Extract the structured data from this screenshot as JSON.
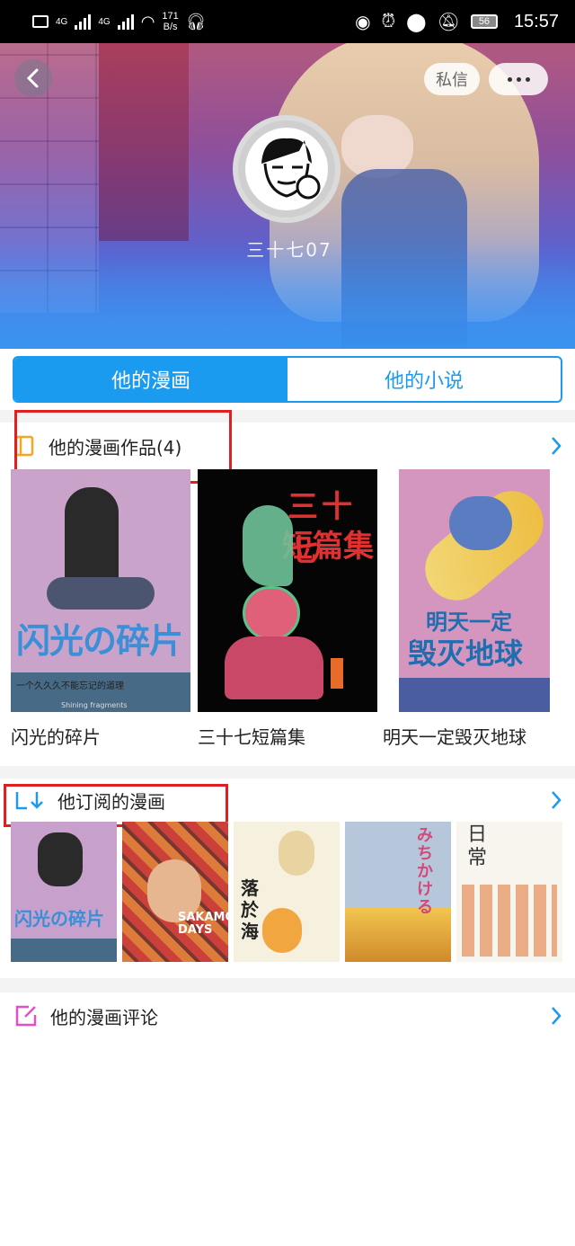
{
  "status_bar": {
    "speed_value": "171",
    "speed_unit": "B/s",
    "network_1": "4G",
    "network_2": "4G",
    "battery": "56",
    "time": "15:57"
  },
  "header": {
    "message_button": "私信",
    "username": "三十七07"
  },
  "tabs": [
    {
      "label": "他的漫画",
      "active": true
    },
    {
      "label": "他的小说",
      "active": false
    }
  ],
  "works_section": {
    "title": "他的漫画作品(4)",
    "items": [
      {
        "title": "闪光的碎片",
        "cover_text": "闪光の碎片",
        "cover_subtext": "一个久久久不能忘记的道理",
        "cover_footer": "Shining fragments"
      },
      {
        "title": "三十七短篇集",
        "cover_text_1": "三十七",
        "cover_text_2": "短篇集"
      },
      {
        "title": "明天一定毁灭地球",
        "cover_text_1": "明天一定",
        "cover_text_2": "毁灭地球"
      }
    ]
  },
  "subscribed_section": {
    "title": "他订阅的漫画",
    "items": [
      {
        "cover_text": "闪光の碎片"
      },
      {
        "cover_text": "SAKAMOTO DAYS"
      },
      {
        "cover_text": "落於海"
      },
      {
        "cover_text": "みちかける"
      },
      {
        "cover_text": "日常"
      }
    ]
  },
  "comments_section": {
    "title": "他的漫画评论"
  },
  "colors": {
    "accent": "#1a9bf0",
    "highlight_box": "#e02020",
    "works_icon": "#f5a623",
    "comments_icon": "#e050c8"
  }
}
